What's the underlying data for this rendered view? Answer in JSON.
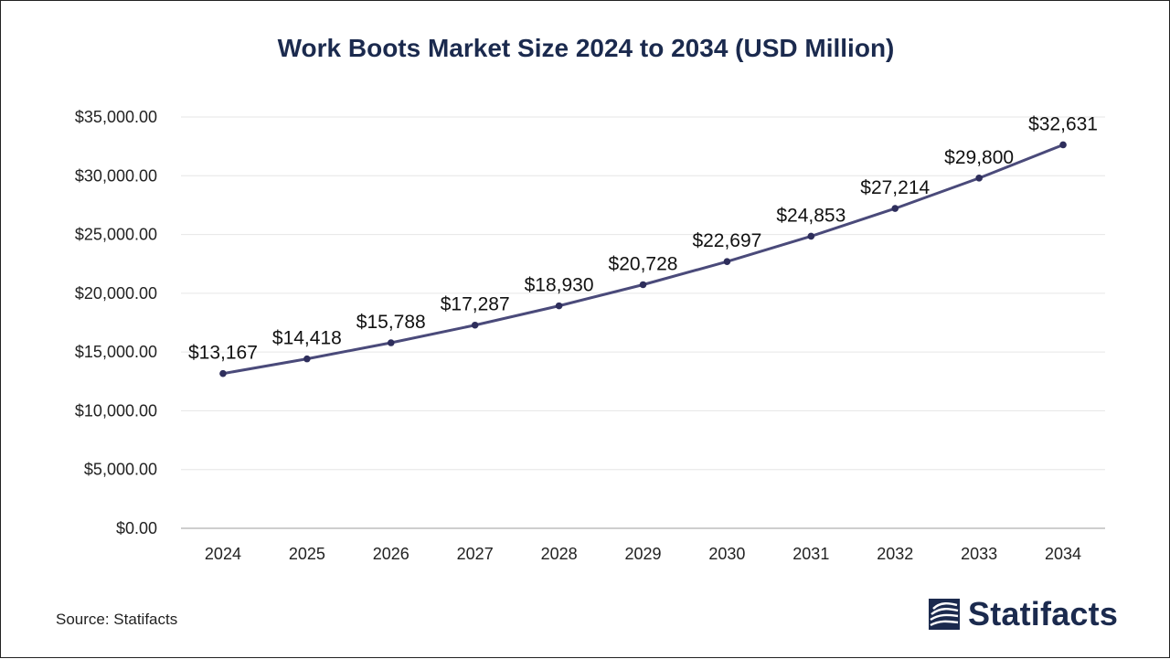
{
  "colors": {
    "line": "#4a4a7a",
    "point": "#2e2e5c",
    "title": "#1b2a4e",
    "grid": "#e6e6e6",
    "axis": "#bdbdbd"
  },
  "source": "Source: Statifacts",
  "brand": {
    "name": "Statifacts",
    "logo_icon": "statifacts-logo-icon"
  },
  "chart_data": {
    "type": "line",
    "title": "Work Boots Market Size 2024 to 2034 (USD Million)",
    "xlabel": "",
    "ylabel": "",
    "x": [
      "2024",
      "2025",
      "2026",
      "2027",
      "2028",
      "2029",
      "2030",
      "2031",
      "2032",
      "2033",
      "2034"
    ],
    "series": [
      {
        "values": [
          13167,
          14418,
          15788,
          17287,
          18930,
          20728,
          22697,
          24853,
          27214,
          29800,
          32631
        ],
        "labels": [
          "$13,167",
          "$14,418",
          "$15,788",
          "$17,287",
          "$18,930",
          "$20,728",
          "$22,697",
          "$24,853",
          "$27,214",
          "$29,800",
          "$32,631"
        ]
      }
    ],
    "ylim": [
      0,
      35000
    ],
    "yticks": [
      0,
      5000,
      10000,
      15000,
      20000,
      25000,
      30000,
      35000
    ],
    "ytick_labels": [
      "$0.00",
      "$5,000.00",
      "$10,000.00",
      "$15,000.00",
      "$20,000.00",
      "$25,000.00",
      "$30,000.00",
      "$35,000.00"
    ],
    "grid": true,
    "legend": "none"
  }
}
